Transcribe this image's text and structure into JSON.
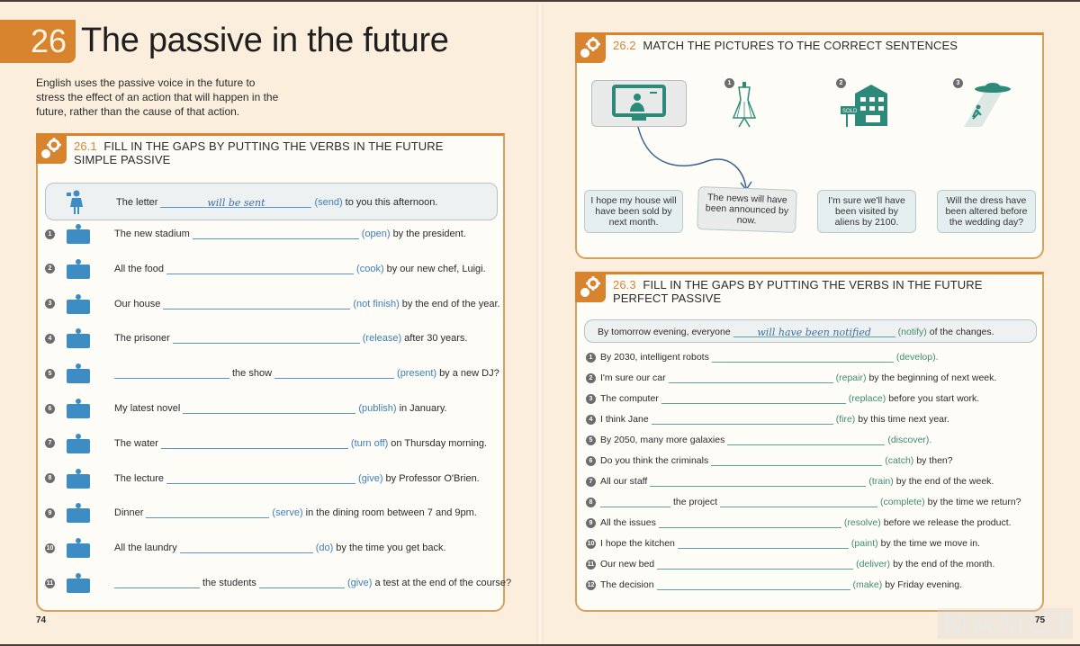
{
  "chapter": {
    "number": "26",
    "title": "The passive in the future",
    "intro": "English uses the passive voice in the future to stress the effect of an action that will happen in the future, rather than the cause of that action."
  },
  "colors": {
    "orange": "#d8842f",
    "blue_verb": "#3d7eb8",
    "green_verb": "#3f8a74",
    "card_bg": "#e5eeee"
  },
  "ex1": {
    "number": "26.1",
    "title_line1": "FILL IN THE GAPS BY PUTTING THE VERBS IN THE FUTURE",
    "title_line2": "SIMPLE PASSIVE",
    "example": {
      "icon": "woman-with-letter-icon",
      "before": "The letter",
      "answer": "will be sent",
      "verb": "(send)",
      "after": "to you this afternoon."
    },
    "items": [
      {
        "n": "1",
        "icon": "stadium-icon",
        "before": "The new stadium",
        "verb": "(open)",
        "after": "by the president."
      },
      {
        "n": "2",
        "icon": "chef-cooking-icon",
        "before": "All the food",
        "verb": "(cook)",
        "after": "by our new chef, Luigi."
      },
      {
        "n": "3",
        "icon": "builder-wall-icon",
        "before": "Our house",
        "verb": "(not finish)",
        "after": "by the end of the year."
      },
      {
        "n": "4",
        "icon": "prison-bars-icon",
        "before": "The prisoner",
        "verb": "(release)",
        "after": "after 30 years."
      },
      {
        "n": "5",
        "icon": "dj-radio-icon",
        "before": "",
        "middle": "the show",
        "verb": "(present)",
        "after": "by a new DJ?"
      },
      {
        "n": "6",
        "icon": "book-icon",
        "before": "My latest novel",
        "verb": "(publish)",
        "after": "in January."
      },
      {
        "n": "7",
        "icon": "plumber-icon",
        "before": "The water",
        "verb": "(turn off)",
        "after": "on Thursday morning."
      },
      {
        "n": "8",
        "icon": "lecture-audience-icon",
        "before": "The lecture",
        "verb": "(give)",
        "after": "by Professor O'Brien."
      },
      {
        "n": "9",
        "icon": "waiter-dining-icon",
        "before": "Dinner",
        "verb": "(serve)",
        "after": "in the dining room between 7 and 9pm."
      },
      {
        "n": "10",
        "icon": "laundry-icon",
        "before": "All the laundry",
        "verb": "(do)",
        "after": "by the time you get back."
      },
      {
        "n": "11",
        "icon": "students-test-icon",
        "before": "",
        "middle": "the students",
        "verb": "(give)",
        "after": "a test at the end of the course?"
      }
    ]
  },
  "ex2": {
    "number": "26.2",
    "title": "MATCH THE PICTURES TO THE CORRECT SENTENCES",
    "pictures": [
      {
        "n": "",
        "icon": "tv-news-icon"
      },
      {
        "n": "1",
        "icon": "dress-mannequin-icon"
      },
      {
        "n": "2",
        "icon": "house-sold-icon"
      },
      {
        "n": "3",
        "icon": "ufo-abduction-icon"
      }
    ],
    "sentences": [
      "I hope my house will have been sold by next month.",
      "The news will have been announced by now.",
      "I'm sure we'll have been visited by aliens by 2100.",
      "Will the dress have been altered before the wedding day?"
    ]
  },
  "ex3": {
    "number": "26.3",
    "title_line1": "FILL IN THE GAPS BY PUTTING THE VERBS IN THE FUTURE",
    "title_line2": "PERFECT PASSIVE",
    "example": {
      "before": "By tomorrow evening, everyone",
      "answer": "will have been notified",
      "verb": "(notify)",
      "after": "of the changes."
    },
    "items": [
      {
        "n": "1",
        "before": "By 2030, intelligent robots",
        "verb": "(develop).",
        "after": ""
      },
      {
        "n": "2",
        "before": "I'm sure our car",
        "verb": "(repair)",
        "after": "by the beginning of next week."
      },
      {
        "n": "3",
        "before": "The computer",
        "verb": "(replace)",
        "after": "before you start work."
      },
      {
        "n": "4",
        "before": "I think Jane",
        "verb": "(fire)",
        "after": "by this time next year."
      },
      {
        "n": "5",
        "before": "By 2050, many more galaxies",
        "verb": "(discover).",
        "after": ""
      },
      {
        "n": "6",
        "before": "Do you think the criminals",
        "verb": "(catch)",
        "after": "by then?"
      },
      {
        "n": "7",
        "before": "All our staff",
        "verb": "(train)",
        "after": "by the end of the week."
      },
      {
        "n": "8",
        "before": "",
        "middle": "the project",
        "verb": "(complete)",
        "after": "by the time we return?"
      },
      {
        "n": "9",
        "before": "All the issues",
        "verb": "(resolve)",
        "after": "before we release the product."
      },
      {
        "n": "10",
        "before": "I hope the kitchen",
        "verb": "(paint)",
        "after": "by the time we move in."
      },
      {
        "n": "11",
        "before": "Our new bed",
        "verb": "(deliver)",
        "after": "by the end of the month."
      },
      {
        "n": "12",
        "before": "The decision",
        "verb": "(make)",
        "after": "by Friday evening."
      }
    ]
  },
  "pages": {
    "left": "74",
    "right": "75"
  },
  "watermark": "MAMUT"
}
